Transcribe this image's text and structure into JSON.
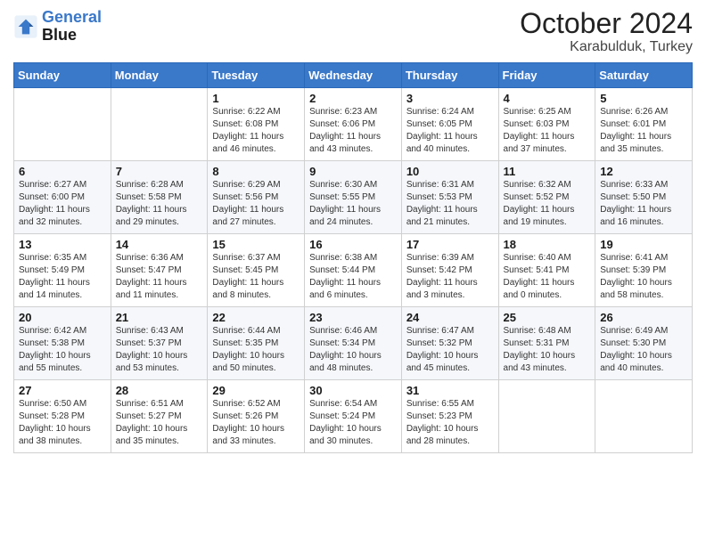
{
  "header": {
    "logo_line1": "General",
    "logo_line2": "Blue",
    "month": "October 2024",
    "location": "Karabulduk, Turkey"
  },
  "weekdays": [
    "Sunday",
    "Monday",
    "Tuesday",
    "Wednesday",
    "Thursday",
    "Friday",
    "Saturday"
  ],
  "weeks": [
    [
      {
        "day": "",
        "sunrise": "",
        "sunset": "",
        "daylight": ""
      },
      {
        "day": "",
        "sunrise": "",
        "sunset": "",
        "daylight": ""
      },
      {
        "day": "1",
        "sunrise": "Sunrise: 6:22 AM",
        "sunset": "Sunset: 6:08 PM",
        "daylight": "Daylight: 11 hours and 46 minutes."
      },
      {
        "day": "2",
        "sunrise": "Sunrise: 6:23 AM",
        "sunset": "Sunset: 6:06 PM",
        "daylight": "Daylight: 11 hours and 43 minutes."
      },
      {
        "day": "3",
        "sunrise": "Sunrise: 6:24 AM",
        "sunset": "Sunset: 6:05 PM",
        "daylight": "Daylight: 11 hours and 40 minutes."
      },
      {
        "day": "4",
        "sunrise": "Sunrise: 6:25 AM",
        "sunset": "Sunset: 6:03 PM",
        "daylight": "Daylight: 11 hours and 37 minutes."
      },
      {
        "day": "5",
        "sunrise": "Sunrise: 6:26 AM",
        "sunset": "Sunset: 6:01 PM",
        "daylight": "Daylight: 11 hours and 35 minutes."
      }
    ],
    [
      {
        "day": "6",
        "sunrise": "Sunrise: 6:27 AM",
        "sunset": "Sunset: 6:00 PM",
        "daylight": "Daylight: 11 hours and 32 minutes."
      },
      {
        "day": "7",
        "sunrise": "Sunrise: 6:28 AM",
        "sunset": "Sunset: 5:58 PM",
        "daylight": "Daylight: 11 hours and 29 minutes."
      },
      {
        "day": "8",
        "sunrise": "Sunrise: 6:29 AM",
        "sunset": "Sunset: 5:56 PM",
        "daylight": "Daylight: 11 hours and 27 minutes."
      },
      {
        "day": "9",
        "sunrise": "Sunrise: 6:30 AM",
        "sunset": "Sunset: 5:55 PM",
        "daylight": "Daylight: 11 hours and 24 minutes."
      },
      {
        "day": "10",
        "sunrise": "Sunrise: 6:31 AM",
        "sunset": "Sunset: 5:53 PM",
        "daylight": "Daylight: 11 hours and 21 minutes."
      },
      {
        "day": "11",
        "sunrise": "Sunrise: 6:32 AM",
        "sunset": "Sunset: 5:52 PM",
        "daylight": "Daylight: 11 hours and 19 minutes."
      },
      {
        "day": "12",
        "sunrise": "Sunrise: 6:33 AM",
        "sunset": "Sunset: 5:50 PM",
        "daylight": "Daylight: 11 hours and 16 minutes."
      }
    ],
    [
      {
        "day": "13",
        "sunrise": "Sunrise: 6:35 AM",
        "sunset": "Sunset: 5:49 PM",
        "daylight": "Daylight: 11 hours and 14 minutes."
      },
      {
        "day": "14",
        "sunrise": "Sunrise: 6:36 AM",
        "sunset": "Sunset: 5:47 PM",
        "daylight": "Daylight: 11 hours and 11 minutes."
      },
      {
        "day": "15",
        "sunrise": "Sunrise: 6:37 AM",
        "sunset": "Sunset: 5:45 PM",
        "daylight": "Daylight: 11 hours and 8 minutes."
      },
      {
        "day": "16",
        "sunrise": "Sunrise: 6:38 AM",
        "sunset": "Sunset: 5:44 PM",
        "daylight": "Daylight: 11 hours and 6 minutes."
      },
      {
        "day": "17",
        "sunrise": "Sunrise: 6:39 AM",
        "sunset": "Sunset: 5:42 PM",
        "daylight": "Daylight: 11 hours and 3 minutes."
      },
      {
        "day": "18",
        "sunrise": "Sunrise: 6:40 AM",
        "sunset": "Sunset: 5:41 PM",
        "daylight": "Daylight: 11 hours and 0 minutes."
      },
      {
        "day": "19",
        "sunrise": "Sunrise: 6:41 AM",
        "sunset": "Sunset: 5:39 PM",
        "daylight": "Daylight: 10 hours and 58 minutes."
      }
    ],
    [
      {
        "day": "20",
        "sunrise": "Sunrise: 6:42 AM",
        "sunset": "Sunset: 5:38 PM",
        "daylight": "Daylight: 10 hours and 55 minutes."
      },
      {
        "day": "21",
        "sunrise": "Sunrise: 6:43 AM",
        "sunset": "Sunset: 5:37 PM",
        "daylight": "Daylight: 10 hours and 53 minutes."
      },
      {
        "day": "22",
        "sunrise": "Sunrise: 6:44 AM",
        "sunset": "Sunset: 5:35 PM",
        "daylight": "Daylight: 10 hours and 50 minutes."
      },
      {
        "day": "23",
        "sunrise": "Sunrise: 6:46 AM",
        "sunset": "Sunset: 5:34 PM",
        "daylight": "Daylight: 10 hours and 48 minutes."
      },
      {
        "day": "24",
        "sunrise": "Sunrise: 6:47 AM",
        "sunset": "Sunset: 5:32 PM",
        "daylight": "Daylight: 10 hours and 45 minutes."
      },
      {
        "day": "25",
        "sunrise": "Sunrise: 6:48 AM",
        "sunset": "Sunset: 5:31 PM",
        "daylight": "Daylight: 10 hours and 43 minutes."
      },
      {
        "day": "26",
        "sunrise": "Sunrise: 6:49 AM",
        "sunset": "Sunset: 5:30 PM",
        "daylight": "Daylight: 10 hours and 40 minutes."
      }
    ],
    [
      {
        "day": "27",
        "sunrise": "Sunrise: 6:50 AM",
        "sunset": "Sunset: 5:28 PM",
        "daylight": "Daylight: 10 hours and 38 minutes."
      },
      {
        "day": "28",
        "sunrise": "Sunrise: 6:51 AM",
        "sunset": "Sunset: 5:27 PM",
        "daylight": "Daylight: 10 hours and 35 minutes."
      },
      {
        "day": "29",
        "sunrise": "Sunrise: 6:52 AM",
        "sunset": "Sunset: 5:26 PM",
        "daylight": "Daylight: 10 hours and 33 minutes."
      },
      {
        "day": "30",
        "sunrise": "Sunrise: 6:54 AM",
        "sunset": "Sunset: 5:24 PM",
        "daylight": "Daylight: 10 hours and 30 minutes."
      },
      {
        "day": "31",
        "sunrise": "Sunrise: 6:55 AM",
        "sunset": "Sunset: 5:23 PM",
        "daylight": "Daylight: 10 hours and 28 minutes."
      },
      {
        "day": "",
        "sunrise": "",
        "sunset": "",
        "daylight": ""
      },
      {
        "day": "",
        "sunrise": "",
        "sunset": "",
        "daylight": ""
      }
    ]
  ]
}
